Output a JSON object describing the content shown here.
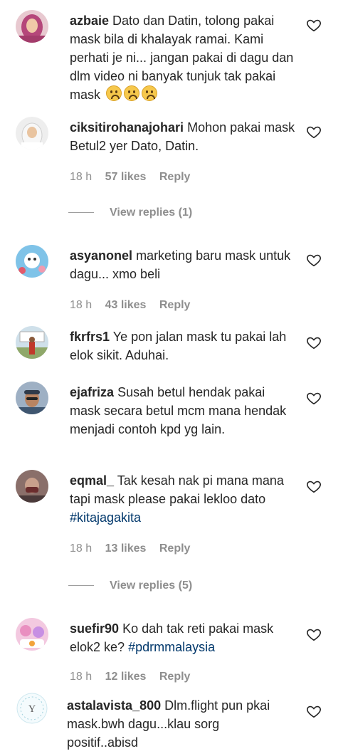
{
  "comments": [
    {
      "username": "azbaie",
      "text": "Dato dan Datin, tolong pakai mask bila di khalayak ramai. Kami perhati je ni... jangan pakai di dagu dan dlm video ni banyak tunjuk tak pakai mask",
      "emoji": "worried-face x3"
    },
    {
      "username": "ciksitirohanajohari",
      "text": "Mohon pakai mask Betul2 yer Dato, Datin.",
      "time": "18 h",
      "likes": "57 likes",
      "reply": "Reply",
      "view_replies": "View replies (1)"
    },
    {
      "username": "asyanonel",
      "text": "marketing baru mask untuk dagu... xmo beli",
      "time": "18 h",
      "likes": "43 likes",
      "reply": "Reply"
    },
    {
      "username": "fkrfrs1",
      "text": "Ye pon jalan mask tu pakai lah elok sikit. Aduhai."
    },
    {
      "username": "ejafriza",
      "text": "Susah betul hendak pakai mask secara betul mcm mana hendak menjadi contoh kpd yg lain."
    },
    {
      "username": "eqmal_",
      "text": "Tak kesah nak pi mana mana tapi mask please pakai lekloo dato",
      "hashtag": "#kitajagakita",
      "time": "18 h",
      "likes": "13 likes",
      "reply": "Reply",
      "view_replies": "View replies (5)"
    },
    {
      "username": "suefir90",
      "text": "Ko dah tak reti pakai mask elok2 ke?",
      "hashtag": "#pdrmmalaysia",
      "time": "18 h",
      "likes": "12 likes",
      "reply": "Reply"
    },
    {
      "username": "astalavista_800",
      "text": "Dlm.flight pun pkai mask.bwh dagu...klau sorg positif..abisd"
    }
  ]
}
